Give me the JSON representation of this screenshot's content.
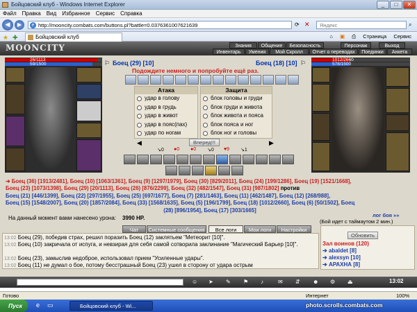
{
  "window": {
    "title": "Бойцовский клуб - Windows Internet Explorer",
    "minimize": "_",
    "maximize": "□",
    "close": "✕"
  },
  "menu": [
    "Файл",
    "Правка",
    "Вид",
    "Избранное",
    "Сервис",
    "Справка"
  ],
  "address": {
    "url": "http://mooncity.combats.com/buttons.pl?battle=0.0376361007621639",
    "search_placeholder": "Яндекс"
  },
  "tab": {
    "label": "Бойцовский клуб",
    "tools": [
      "Страница",
      "Сервис"
    ]
  },
  "site": {
    "logo": "MOONCITY",
    "nav_top": [
      "Знания",
      "Общение",
      "Безопасность",
      "Персонаж",
      "Выход"
    ],
    "nav_bottom": [
      "Инвентарь",
      "Умения",
      "Мой Скролл",
      "Отчет о переводах",
      "Поединки",
      "Анкета"
    ]
  },
  "left_fighter": {
    "name": "Боец (29) [10]",
    "hp": "26/1113",
    "mp": "59/1500",
    "hp_fraction": 0.95,
    "mp_fraction": 0.9
  },
  "right_fighter": {
    "name": "Боец (18) [10]",
    "hp": "1012/2660",
    "mp": "578/1500",
    "hp_fraction": 0.38,
    "mp_fraction": 0.39
  },
  "wait_message": "Подождите немного и попробуйте ещё раз.",
  "attack": {
    "title": "Атака",
    "options": [
      "удар в голову",
      "удар в грудь",
      "удар в живот",
      "удар в пояс(пах)",
      "удар по ногам"
    ]
  },
  "defense": {
    "title": "Защита",
    "options": [
      "блок головы и груди",
      "блок груди и живота",
      "блок живота и пояса",
      "блок пояса и ног",
      "блок ног и головы"
    ]
  },
  "forward_button": "Вперед!!!",
  "counters": [
    "0",
    "0",
    "0",
    "0",
    "9",
    "1"
  ],
  "teams_text_1": "Боец (36) [1913/2481], Боец (10) [1063/1361], Боец (9) [1297/1979], Боец (30) [829/2011], Боец (24) [199/1286], Боец (19) [1521/1668],",
  "teams_text_2": "Боец (23) [1073/1398], Боец (29) [20/1113], Боец (26) [876/2299], Боец (32) [482/1547], Боец (31) [987/1802]",
  "vs_word": "против",
  "teams_text_3": "Боец (21) [446/1399], Боец (22) [297/1955], Боец (25) [697/1677], Боец (7) [281/1463], Боец (11) [462/1487], Боец (12) [268/988],",
  "teams_text_4": "Боец (15) [1548/2007], Боец (20) [1857/2084], Боец (33) [1568/1635], Боец (5) [196/1799], Боец (18) [1012/2660], Боец (6) [50/1502], Боец",
  "teams_text_5": "(28) [896/1954], Боец (17) [303/1665]",
  "battle_log": "лог боя »»",
  "damage_label": "На данный момент вами нанесено урона:",
  "damage_value": "3990 HP.",
  "timeout": "(Бой идет с таймаутом 2 мин.)",
  "chat_tabs": [
    "Чат",
    "Системные сообщения",
    "Все логи",
    "Мои логи",
    "Настройки"
  ],
  "messages": [
    {
      "time": "13:02",
      "text": "Боец (29), победив страх, решил поразить Боец (12) заклятьем \"Метеорит [10]\"."
    },
    {
      "time": "13:02",
      "text": "Боец (10) закричала от испуга, и невзирая для себя самой сотворила заклинание \"Магический Барьер [10]\"."
    },
    {
      "time": "13:02",
      "text": "Боец (23), замыслив недоброе, использовал прием \"Усиленные удары\"."
    },
    {
      "time": "13:02",
      "text": "Боец (11) не думал о бое, потому бесстрашный Боец (23) ушел в сторону от удара острым"
    }
  ],
  "refresh_button": "Обновить",
  "room": {
    "title": "Зал воинов (120)",
    "users": [
      "abaldet [8]",
      "alexsyn [10]",
      "АРАХНА [8]"
    ]
  },
  "statusbar": {
    "left": "Готово",
    "zone": "Интернет",
    "zoom": "100%"
  },
  "taskbar": {
    "start": "Пуск",
    "item": "Бойцовский клуб - Wi...",
    "clock": "13:02"
  },
  "watermark": "photo.scrolls.combats.com"
}
